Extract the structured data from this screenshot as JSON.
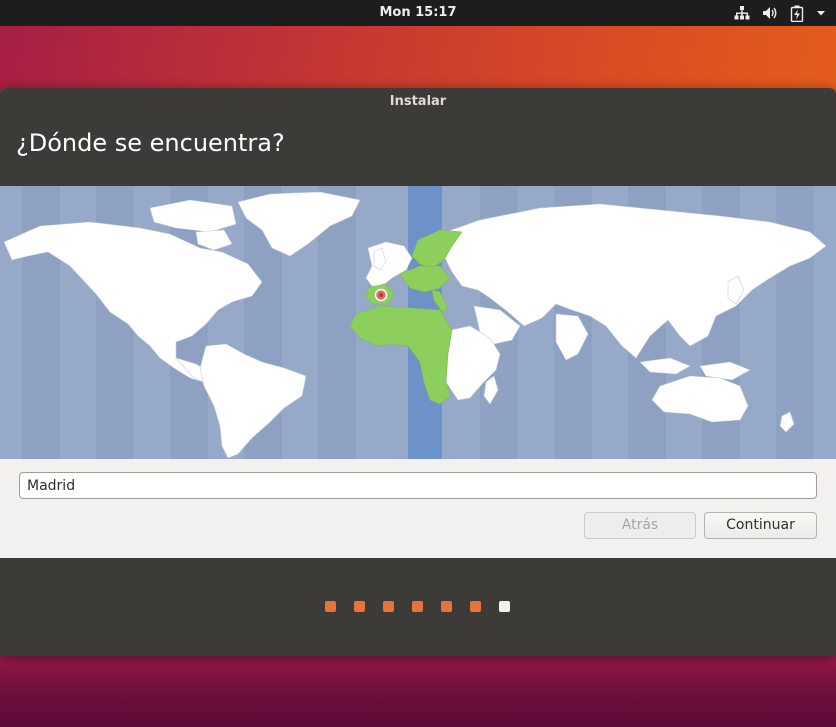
{
  "topbar": {
    "clock": "Mon 15:17",
    "icons": [
      "network-wired-icon",
      "speaker-volume-icon",
      "battery-charging-icon",
      "system-menu-arrow-icon"
    ]
  },
  "window": {
    "title": "Instalar"
  },
  "header": {
    "title": "¿Dónde se encuentra?"
  },
  "map": {
    "selected_city_marker": "Madrid",
    "highlight_color": "#8ccf5c",
    "timezone_band_color": "#6d91c9",
    "ocean_color": "#97a9c9",
    "land_color": "#ffffff"
  },
  "location": {
    "value": "Madrid"
  },
  "buttons": {
    "back_label": "Atrás",
    "back_enabled": false,
    "continue_label": "Continuar"
  },
  "progress": {
    "total_steps": 7,
    "current_step": 7,
    "active_color": "#e9733c",
    "current_color": "#f0f0f0"
  }
}
